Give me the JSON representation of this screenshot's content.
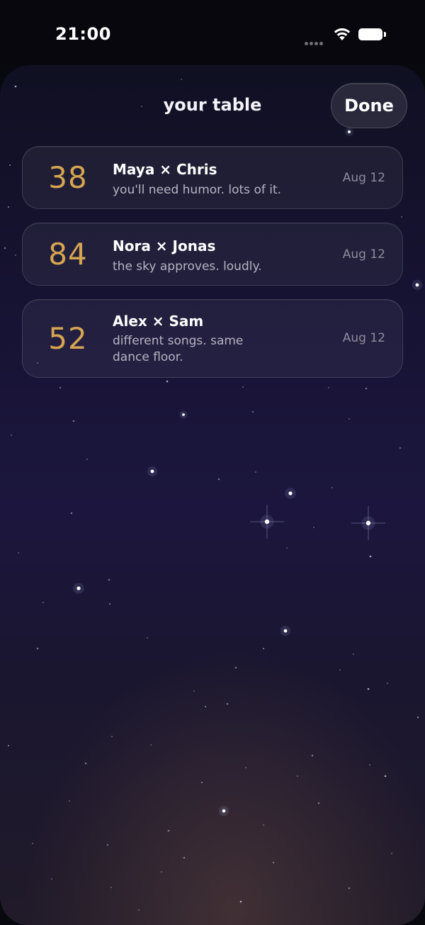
{
  "status_bar": {
    "time": "21:00"
  },
  "header": {
    "title": "your table",
    "done_label": "Done"
  },
  "matches": [
    {
      "score": "38",
      "names": "Maya × Chris",
      "message": "you'll need humor. lots of it.",
      "date": "Aug 12"
    },
    {
      "score": "84",
      "names": "Nora × Jonas",
      "message": "the sky approves. loudly.",
      "date": "Aug 12"
    },
    {
      "score": "52",
      "names": "Alex × Sam",
      "message": "different songs. same dance floor.",
      "date": "Aug 12"
    }
  ],
  "colors": {
    "score_accent": "#d6a551",
    "background_top": "#101022",
    "background_mid": "#1c163e",
    "background_glow": "#5c423e"
  },
  "icons": [
    "signal-icon",
    "wifi-icon",
    "battery-icon",
    "star-icon"
  ]
}
